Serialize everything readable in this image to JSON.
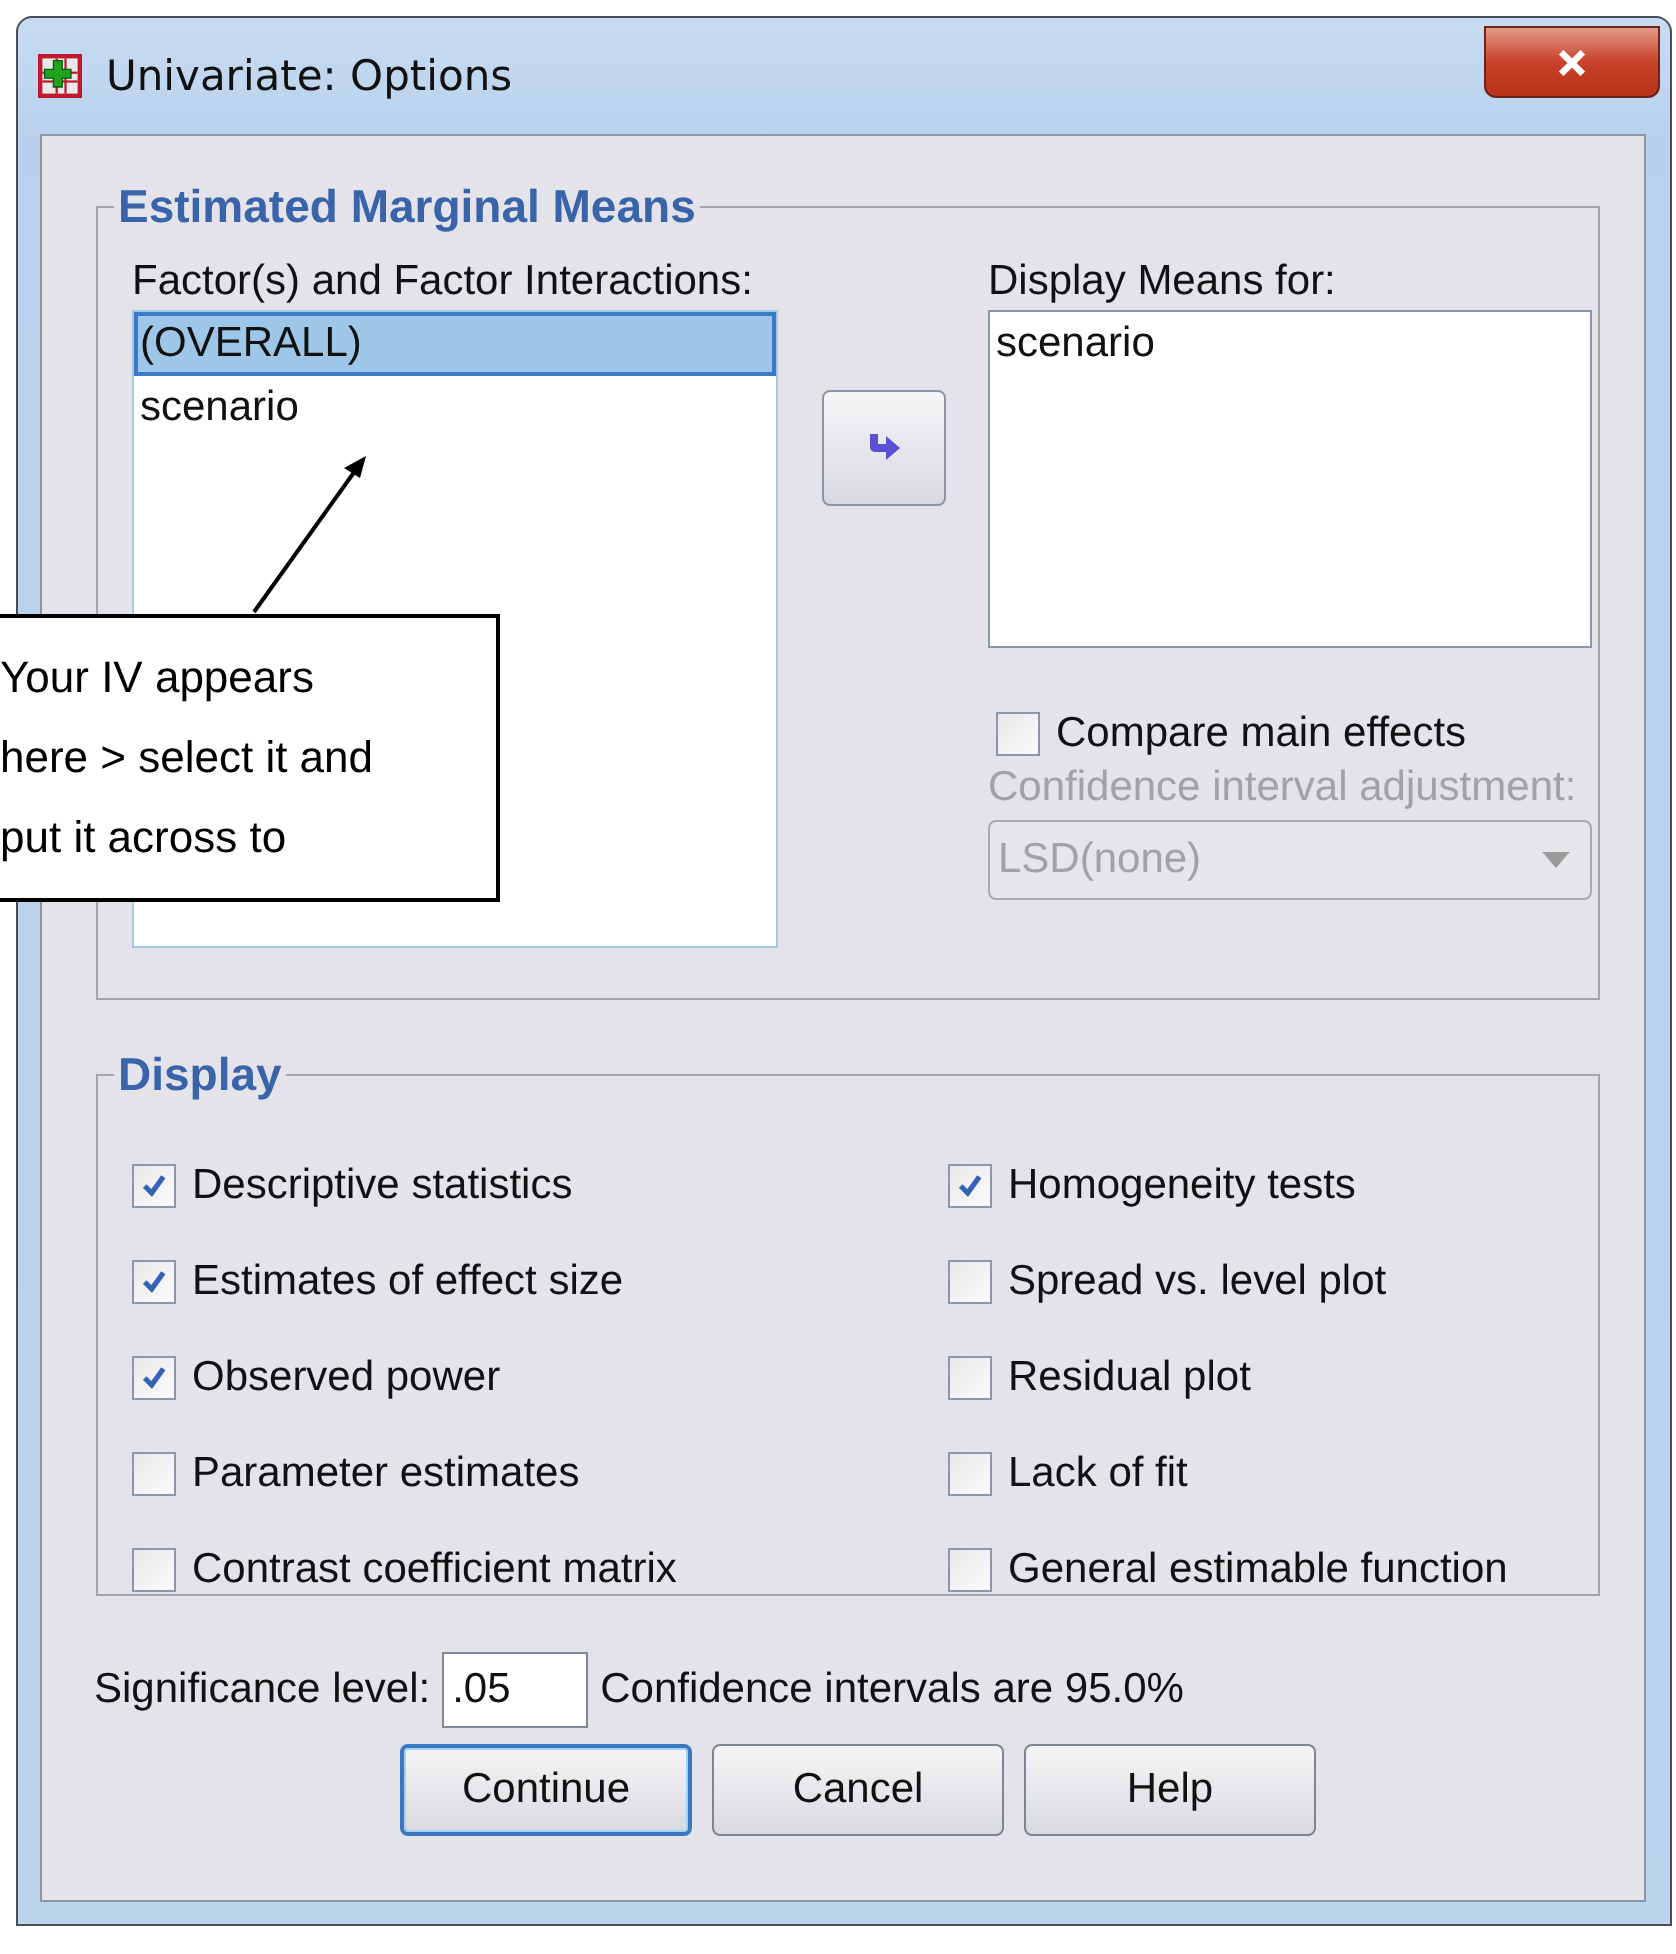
{
  "window": {
    "title": "Univariate: Options"
  },
  "estimated_marginal_means": {
    "title": "Estimated Marginal Means",
    "factors_label": "Factor(s) and Factor Interactions:",
    "factors": [
      {
        "label": "(OVERALL)",
        "selected": true
      },
      {
        "label": "scenario",
        "selected": false
      }
    ],
    "display_means_label": "Display Means for:",
    "display_means": [
      "scenario"
    ],
    "compare_main_effects": {
      "label": "Compare main effects",
      "checked": false
    },
    "ci_adjustment": {
      "label": "Confidence interval adjustment:",
      "value": "LSD(none)",
      "disabled": true
    }
  },
  "display": {
    "title": "Display",
    "options": [
      {
        "label": "Descriptive statistics",
        "checked": true
      },
      {
        "label": "Homogeneity tests",
        "checked": true
      },
      {
        "label": "Estimates of effect size",
        "checked": true
      },
      {
        "label": "Spread vs. level plot",
        "checked": false
      },
      {
        "label": "Observed power",
        "checked": true
      },
      {
        "label": "Residual plot",
        "checked": false
      },
      {
        "label": "Parameter estimates",
        "checked": false
      },
      {
        "label": "Lack of fit",
        "checked": false
      },
      {
        "label": "Contrast coefficient matrix",
        "checked": false
      },
      {
        "label": "General estimable function",
        "checked": false
      }
    ]
  },
  "significance": {
    "label": "Significance level:",
    "value": ".05",
    "note": "Confidence intervals are 95.0%"
  },
  "buttons": [
    {
      "label": "Continue",
      "default": true
    },
    {
      "label": "Cancel",
      "default": false
    },
    {
      "label": "Help",
      "default": false
    }
  ],
  "callout": {
    "lines": [
      "Your IV appears",
      "here > select it and",
      "put it across to"
    ]
  }
}
